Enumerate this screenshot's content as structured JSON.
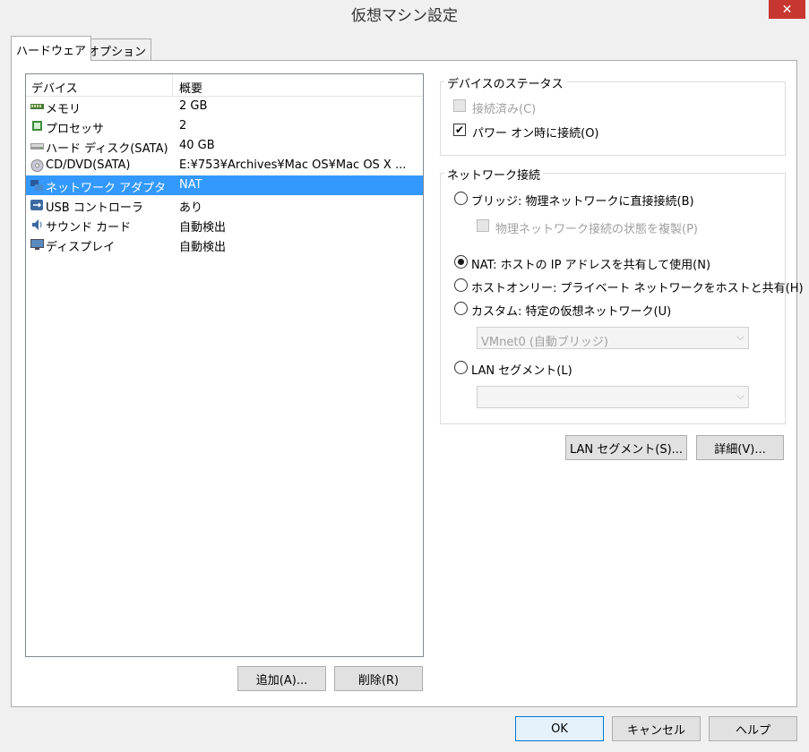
{
  "window": {
    "title": "仮想マシン設定",
    "close_glyph": "✕"
  },
  "tabs": [
    {
      "label": "ハードウェア"
    },
    {
      "label": "オプション"
    }
  ],
  "device_list": {
    "headers": {
      "device": "デバイス",
      "summary": "概要"
    },
    "rows": [
      {
        "name": "メモリ",
        "summary": "2 GB",
        "icon": "memory-icon"
      },
      {
        "name": "プロセッサ",
        "summary": "2",
        "icon": "processor-icon"
      },
      {
        "name": "ハード ディスク(SATA)",
        "summary": "40 GB",
        "icon": "hard-disk-icon"
      },
      {
        "name": "CD/DVD(SATA)",
        "summary": "E:¥753¥Archives¥Mac OS¥Mac OS X ...",
        "icon": "cd-dvd-icon"
      },
      {
        "name": "ネットワーク アダプタ",
        "summary": "NAT",
        "icon": "network-adapter-icon"
      },
      {
        "name": "USB コントローラ",
        "summary": "あり",
        "icon": "usb-icon"
      },
      {
        "name": "サウンド カード",
        "summary": "自動検出",
        "icon": "sound-card-icon"
      },
      {
        "name": "ディスプレイ",
        "summary": "自動検出",
        "icon": "display-icon"
      }
    ],
    "selected_index": 4,
    "add_button": "追加(A)...",
    "remove_button": "削除(R)"
  },
  "device_status": {
    "title": "デバイスのステータス",
    "connected": {
      "label": "接続済み(C)",
      "checked": false,
      "enabled": false
    },
    "connect_at_power_on": {
      "label": "パワー オン時に接続(O)",
      "checked": true,
      "enabled": true
    }
  },
  "network_connection": {
    "title": "ネットワーク接続",
    "bridge": {
      "label": "ブリッジ: 物理ネットワークに直接接続(B)"
    },
    "replicate": {
      "label": "物理ネットワーク接続の状態を複製(P)",
      "checked": false,
      "enabled": false
    },
    "nat": {
      "label": "NAT: ホストの IP アドレスを共有して使用(N)",
      "selected": true
    },
    "host_only": {
      "label": "ホストオンリー: プライベート ネットワークをホストと共有(H)"
    },
    "custom": {
      "label": "カスタム: 特定の仮想ネットワーク(U)"
    },
    "custom_combo": {
      "value": "VMnet0 (自動ブリッジ)"
    },
    "lan_segment": {
      "label": "LAN セグメント(L)"
    },
    "lan_combo": {
      "value": ""
    }
  },
  "panel_buttons": {
    "lan_segments": "LAN セグメント(S)...",
    "advanced": "詳細(V)..."
  },
  "dialog_buttons": {
    "ok": "OK",
    "cancel": "キャンセル",
    "help": "ヘルプ"
  }
}
